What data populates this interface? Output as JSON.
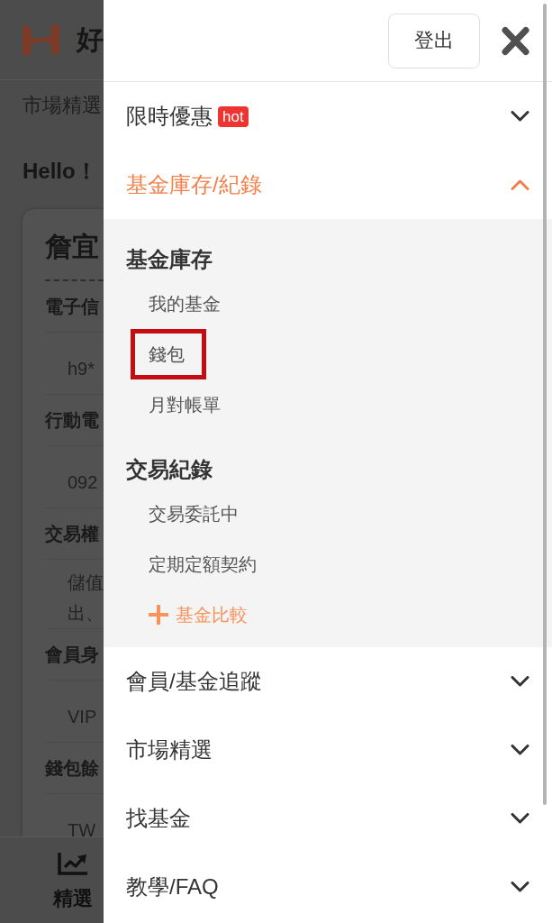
{
  "background_page": {
    "logo_text": "好",
    "breadcrumb": "市場精選",
    "greeting": "Hello！",
    "profile_card": {
      "name": "詹宜",
      "fields": [
        {
          "label": "電子信",
          "value_lines": [
            "h9*"
          ]
        },
        {
          "label": "行動電",
          "value_lines": [
            "092"
          ]
        },
        {
          "label": "交易權",
          "value_lines": [
            "儲值",
            "出、"
          ]
        },
        {
          "label": "會員身",
          "value_lines": [
            "VIP"
          ]
        },
        {
          "label": "錢包餘",
          "value_lines": [
            "TW"
          ]
        }
      ]
    },
    "bottom_nav": [
      {
        "label": "精選"
      }
    ]
  },
  "drawer": {
    "logout_button": "登出",
    "menu": [
      {
        "label": "限時優惠",
        "badge": "hot",
        "expanded": false
      },
      {
        "label": "基金庫存/紀錄",
        "expanded": true,
        "groups": [
          {
            "title": "基金庫存",
            "items": [
              {
                "label": "我的基金",
                "highlighted": false
              },
              {
                "label": "錢包",
                "highlighted": true
              },
              {
                "label": "月對帳單",
                "highlighted": false
              }
            ]
          },
          {
            "title": "交易紀錄",
            "items": [
              {
                "label": "交易委託中",
                "highlighted": false
              },
              {
                "label": "定期定額契約",
                "highlighted": false
              }
            ]
          }
        ],
        "action": {
          "label": "基金比較"
        }
      },
      {
        "label": "會員/基金追蹤",
        "expanded": false
      },
      {
        "label": "市場精選",
        "expanded": false
      },
      {
        "label": "找基金",
        "expanded": false
      },
      {
        "label": "教學/FAQ",
        "expanded": false
      }
    ]
  }
}
